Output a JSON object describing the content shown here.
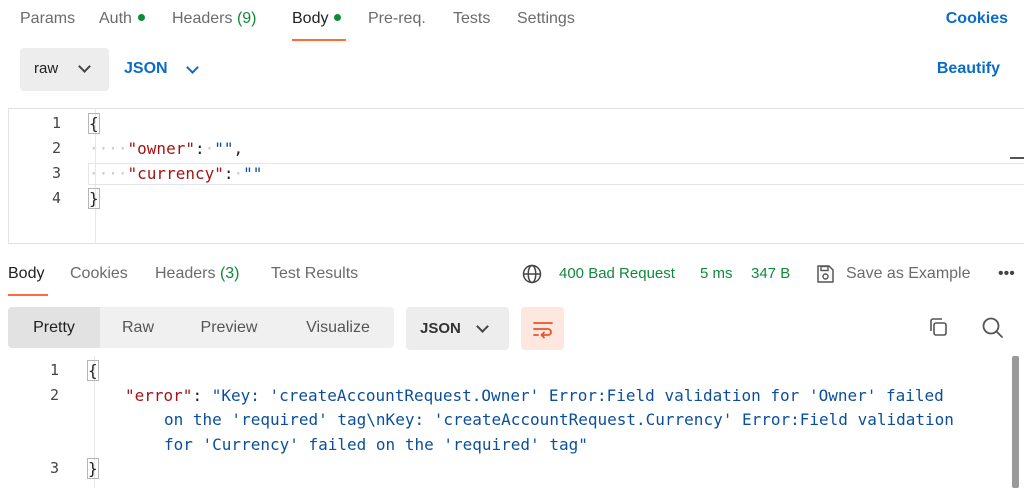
{
  "request_tabs": {
    "params": "Params",
    "auth": "Auth",
    "headers": "Headers",
    "headers_count": "(9)",
    "body": "Body",
    "prereq": "Pre-req.",
    "tests": "Tests",
    "settings": "Settings",
    "cookies": "Cookies"
  },
  "body_mode": {
    "mode": "raw",
    "language": "JSON",
    "beautify": "Beautify"
  },
  "request_editor": {
    "line_numbers": [
      "1",
      "2",
      "3",
      "4"
    ],
    "lines": {
      "open_brace": "{",
      "owner_key": "\"owner\"",
      "owner_value": "\"\"",
      "currency_key": "\"currency\"",
      "currency_value": "\"\"",
      "close_brace": "}"
    }
  },
  "response_tabs": {
    "body": "Body",
    "cookies": "Cookies",
    "headers": "Headers",
    "headers_count": "(3)",
    "test_results": "Test Results"
  },
  "response_status": {
    "status": "400 Bad Request",
    "time": "5 ms",
    "size": "347 B",
    "save_example": "Save as Example"
  },
  "view_modes": {
    "pretty": "Pretty",
    "raw": "Raw",
    "preview": "Preview",
    "visualize": "Visualize",
    "format": "JSON"
  },
  "response_editor": {
    "line_numbers": [
      "1",
      "2",
      "3"
    ],
    "open_brace": "{",
    "error_key": "\"error\"",
    "error_value_line1": "\"Key: 'createAccountRequest.Owner' Error:Field validation for 'Owner' failed",
    "error_value_line2": "on the 'required' tag\\nKey: 'createAccountRequest.Currency' Error:Field validation",
    "error_value_line3": "for 'Currency' failed on the 'required' tag\"",
    "close_brace": "}"
  },
  "colors": {
    "accent_orange": "#ff6c37",
    "link_blue": "#0b6bcb",
    "success_green": "#0f8a3b",
    "json_key": "#a31515",
    "json_string": "#0b4f9c"
  }
}
